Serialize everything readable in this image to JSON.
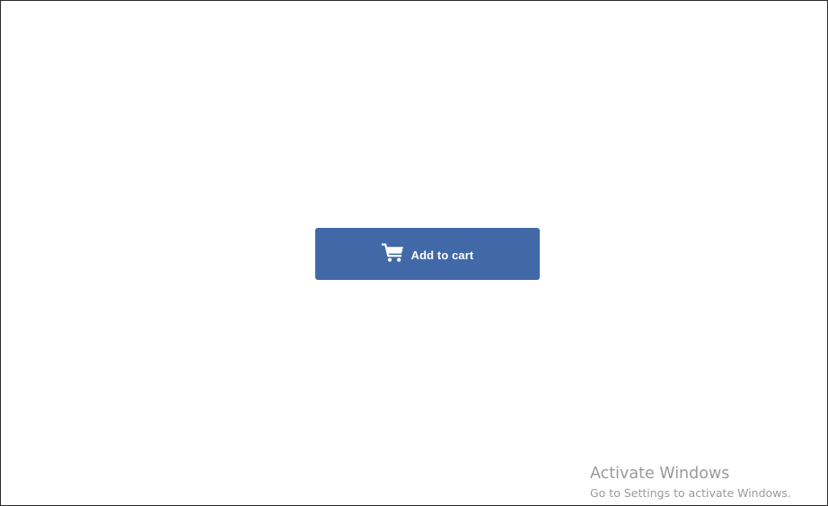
{
  "add_to_cart_button": {
    "label": "Add to cart",
    "icon": "shopping-cart-icon",
    "background_color": "#4169a8",
    "text_color": "#ffffff"
  },
  "watermark": {
    "title": "Activate Windows",
    "subtitle": "Go to Settings to activate Windows."
  }
}
